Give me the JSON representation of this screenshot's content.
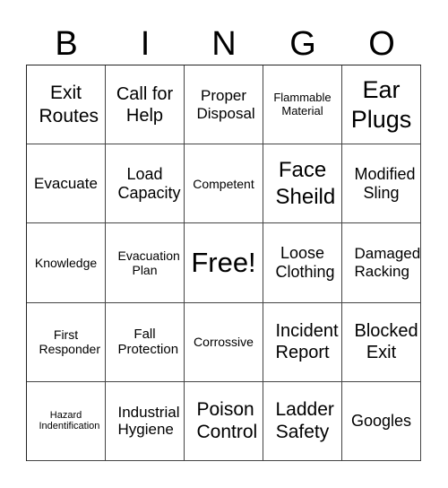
{
  "header": {
    "letters": [
      "B",
      "I",
      "N",
      "G",
      "O"
    ]
  },
  "board": {
    "rows": [
      [
        "Exit Routes",
        "Call for Help",
        "Proper Disposal",
        "Flammable Material",
        "Ear Plugs"
      ],
      [
        "Evacuate",
        "Load Capacity",
        "Competent",
        "Face Sheild",
        "Modified Sling"
      ],
      [
        "Knowledge",
        "Evacuation Plan",
        "Free!",
        "Loose Clothing",
        "Damaged Racking"
      ],
      [
        "First Responder",
        "Fall Protection",
        "Corrossive",
        "Incident Report",
        "Blocked Exit"
      ],
      [
        "Hazard Indentification",
        "Industrial Hygiene",
        "Poison Control",
        "Ladder Safety",
        "Googles"
      ]
    ],
    "free_space": "Free!"
  }
}
